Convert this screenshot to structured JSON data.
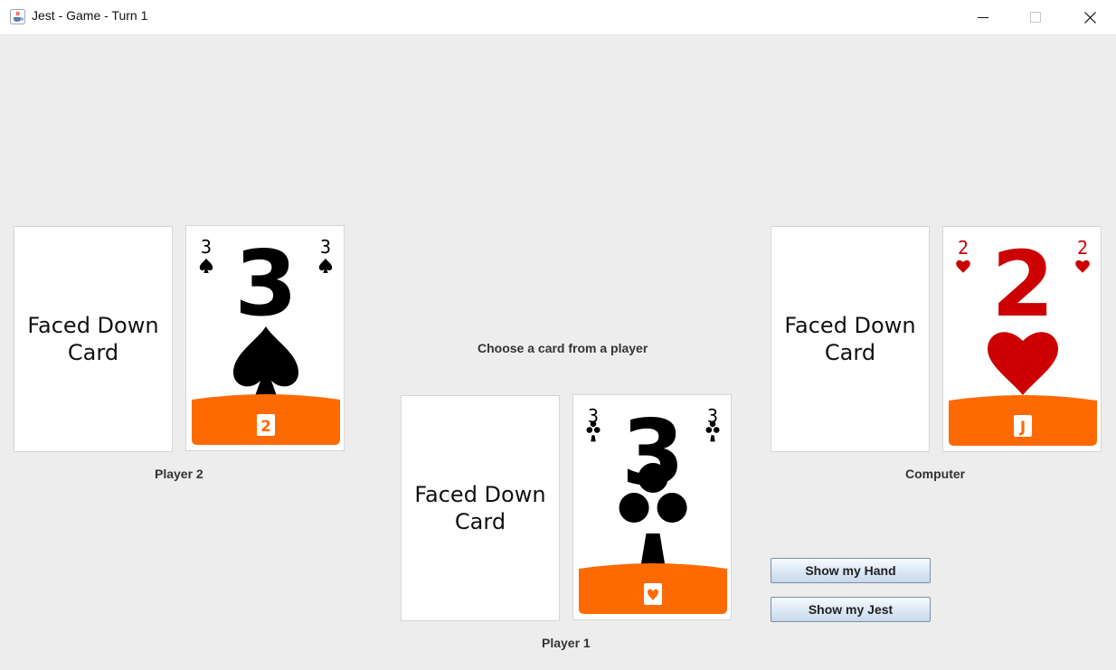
{
  "window": {
    "title": "Jest - Game - Turn 1",
    "app_icon": "java-cup-icon",
    "controls": [
      "minimize-icon",
      "maximize-icon",
      "close-icon"
    ]
  },
  "prompt": "Choose a card from a player",
  "players": [
    {
      "name": "Player 2",
      "facedown_label": "Faced Down\nCard",
      "faceup": {
        "rank": "3",
        "suit": "spade",
        "suit_glyph": "♠",
        "color": "#000000",
        "trophy": "2"
      }
    },
    {
      "name": "Computer",
      "facedown_label": "Faced Down\nCard",
      "faceup": {
        "rank": "2",
        "suit": "heart",
        "suit_glyph": "♥",
        "color": "#cc0000",
        "trophy": "J"
      }
    },
    {
      "name": "Player 1",
      "facedown_label": "Faced Down\nCard",
      "faceup": {
        "rank": "3",
        "suit": "club",
        "suit_glyph": "♣",
        "color": "#000000",
        "trophy": "♥"
      }
    }
  ],
  "buttons": {
    "show_hand": "Show my Hand",
    "show_jest": "Show my Jest"
  },
  "colors": {
    "trophy_band": "#ff6a00",
    "background": "#ededed"
  }
}
